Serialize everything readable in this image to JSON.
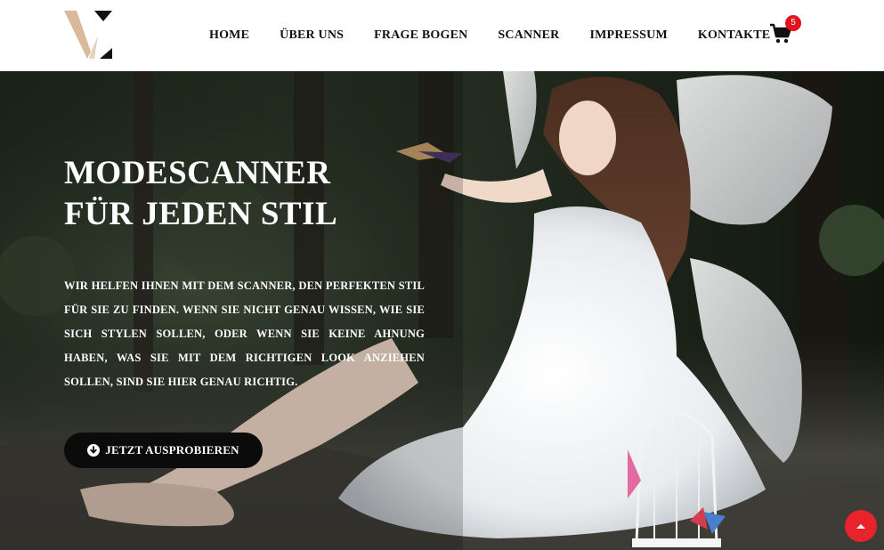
{
  "nav": {
    "items": [
      {
        "label": "HOME"
      },
      {
        "label": "ÜBER UNS"
      },
      {
        "label": "FRAGE BOGEN"
      },
      {
        "label": "SCANNER"
      },
      {
        "label": "IMPRESSUM"
      },
      {
        "label": "KONTAKTE"
      }
    ],
    "cart_count": "5",
    "cart_icon": "shopping-cart-icon"
  },
  "hero": {
    "title_line1": "MODESCANNER",
    "title_line2": "FÜR JEDEN STIL",
    "text": "Wir helfen Ihnen mit dem Scanner, den perfekten Stil für Sie zu finden. Wenn Sie nicht genau wissen, wie Sie sich stylen sollen, oder wenn Sie keine Ahnung haben, was Sie mit dem richtigen Look anziehen sollen, sind Sie hier genau richtig.",
    "cta_label": "JETZT AUSPROBIEREN",
    "cta_icon": "arrow-circle-down-icon"
  },
  "colors": {
    "accent_red": "#e8232b",
    "badge_red": "#e3131b",
    "logo_beige": "#d9b99a",
    "button_black": "#0b0b0b"
  },
  "scroll_top_icon": "caret-up-icon"
}
